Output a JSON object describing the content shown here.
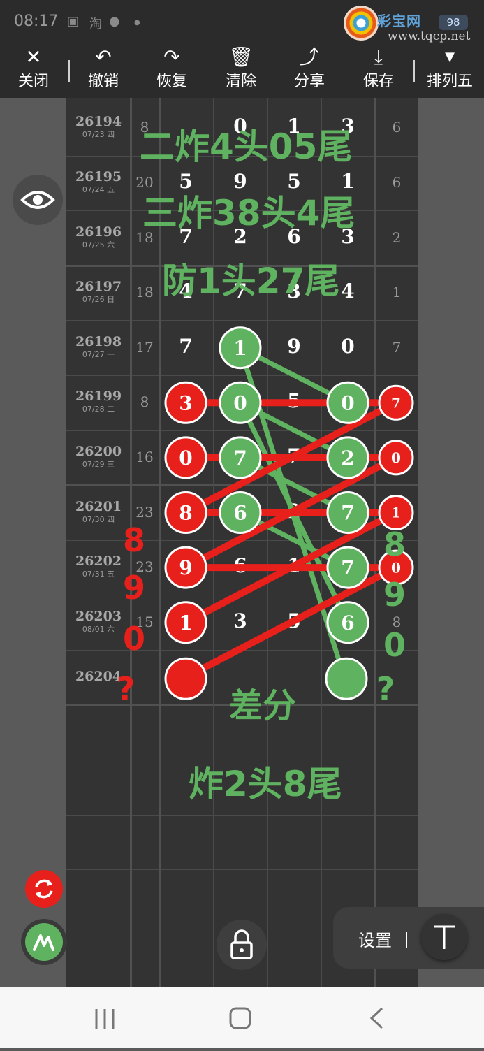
{
  "status_bar": {
    "time": "08:17",
    "battery": "98",
    "logo_text": "彩宝网",
    "logo_url": "www.tqcp.net"
  },
  "toolbar": {
    "close": "关闭",
    "undo": "撤销",
    "redo": "恢复",
    "clear": "清除",
    "share": "分享",
    "save": "保存",
    "lottery": "排列五"
  },
  "rows": [
    {
      "period": "26194",
      "date": "07/23 四",
      "sum": "8",
      "digits": [
        "",
        "0",
        "1",
        "3"
      ],
      "span": "6"
    },
    {
      "period": "26195",
      "date": "07/24 五",
      "sum": "20",
      "digits": [
        "5",
        "9",
        "5",
        "1"
      ],
      "span": "6"
    },
    {
      "period": "26196",
      "date": "07/25 六",
      "sum": "18",
      "digits": [
        "7",
        "2",
        "6",
        "3"
      ],
      "span": "2"
    },
    {
      "period": "26197",
      "date": "07/26 日",
      "sum": "18",
      "digits": [
        "4",
        "7",
        "3",
        "4"
      ],
      "span": "1"
    },
    {
      "period": "26198",
      "date": "07/27 一",
      "sum": "17",
      "digits": [
        "7",
        "1",
        "9",
        "0"
      ],
      "span": "7"
    },
    {
      "period": "26199",
      "date": "07/28 二",
      "sum": "8",
      "digits": [
        "3",
        "0",
        "5",
        "0"
      ],
      "span": "7"
    },
    {
      "period": "26200",
      "date": "07/29 三",
      "sum": "16",
      "digits": [
        "0",
        "7",
        "7",
        "2"
      ],
      "span": "0"
    },
    {
      "period": "26201",
      "date": "07/30 四",
      "sum": "23",
      "digits": [
        "8",
        "6",
        "2",
        "7"
      ],
      "span": "1"
    },
    {
      "period": "26202",
      "date": "07/31 五",
      "sum": "23",
      "digits": [
        "9",
        "6",
        "1",
        "7"
      ],
      "span": "0"
    },
    {
      "period": "26203",
      "date": "08/01 六",
      "sum": "15",
      "digits": [
        "1",
        "3",
        "5",
        "6"
      ],
      "span": "8"
    },
    {
      "period": "26204",
      "date": "",
      "sum": "",
      "digits": [
        "",
        "",
        "",
        ""
      ],
      "span": ""
    }
  ],
  "annotations": {
    "line1": "二炸4头05尾",
    "line2": "三炸38头4尾",
    "line3": "防1头27尾",
    "diff_label": "差分",
    "bottom": "炸2头8尾",
    "left_red": [
      "8",
      "9",
      "0",
      "?"
    ],
    "right_green": [
      "8",
      "9",
      "0",
      "?"
    ]
  },
  "colors": {
    "red": "#e8201c",
    "green": "#5fb25f",
    "panel": "#333333",
    "toolbar": "#2b2b2b"
  },
  "controls": {
    "settings": "设置",
    "eye_icon": "eye-icon",
    "refresh_icon": "refresh-icon",
    "pen_icon": "pen-icon",
    "lock_icon": "lock-icon",
    "text_tool_icon": "text-tool-icon"
  }
}
